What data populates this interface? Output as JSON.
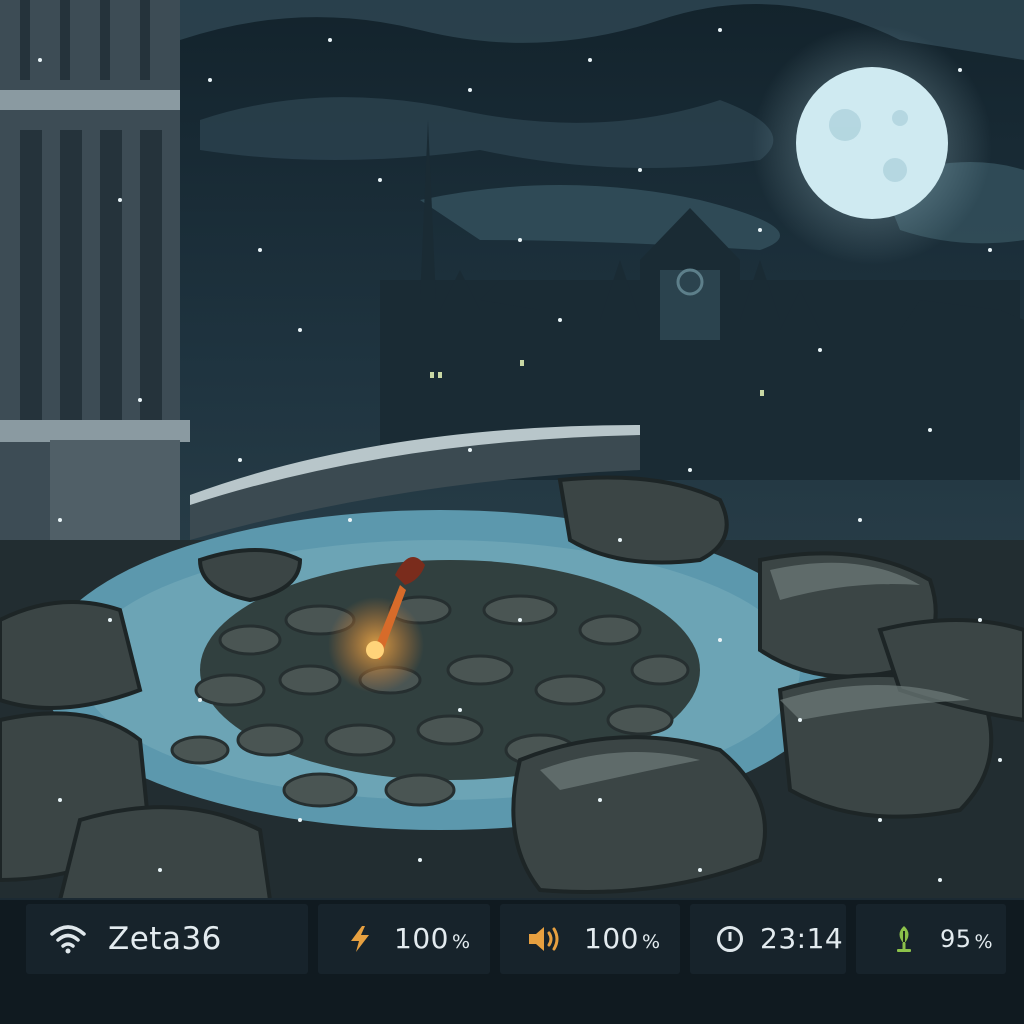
{
  "status_bar": {
    "network": {
      "icon": "wifi-icon",
      "name": "Zeta36"
    },
    "charge": {
      "icon": "lightning-bolt-icon",
      "value": "100",
      "unit": "%"
    },
    "volume": {
      "icon": "speaker-icon",
      "value": "100",
      "unit": "%"
    },
    "clock": {
      "icon": "clock-icon",
      "time": "23:14"
    },
    "thermal": {
      "icon": "leaf-thermometer-icon",
      "value": "95",
      "unit": "%"
    }
  },
  "colors": {
    "night_sky": "#1b2d37",
    "moon": "#cfeaf1",
    "snow_water": "#5c98ad",
    "rock": "#3b4544",
    "fire": "#f3a13a",
    "status_bg": "#17232b",
    "charge_accent": "#e7a040",
    "volume_accent": "#e7a040",
    "thermal_accent": "#8cc24a",
    "status_text": "#e3ebef"
  }
}
